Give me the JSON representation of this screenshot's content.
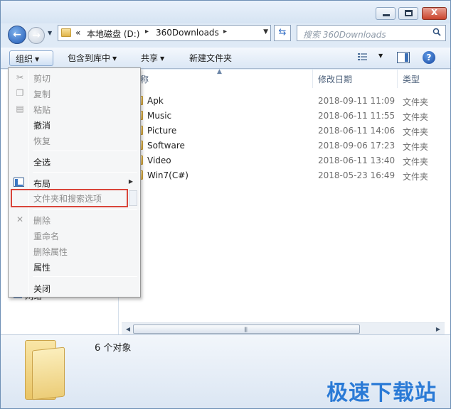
{
  "titlebar": {
    "minimize_glyph": "",
    "maximize_glyph": "",
    "close_glyph": "x"
  },
  "nav": {
    "back_glyph": "←",
    "forward_glyph": "→"
  },
  "address": {
    "overflow": "«",
    "crumbs": [
      "本地磁盘 (D:)",
      "360Downloads"
    ],
    "separator": "▸"
  },
  "search": {
    "placeholder": "搜索 360Downloads"
  },
  "toolbar": {
    "organize": "组织",
    "include_library": "包含到库中",
    "share": "共享",
    "new_folder": "新建文件夹",
    "dropdown": "▼"
  },
  "columns": {
    "name": "名称",
    "date": "修改日期",
    "type": "类型"
  },
  "files": [
    {
      "name": "Apk",
      "date": "2018-09-11 11:09",
      "type": "文件夹"
    },
    {
      "name": "Music",
      "date": "2018-06-11 11:55",
      "type": "文件夹"
    },
    {
      "name": "Picture",
      "date": "2018-06-11 14:06",
      "type": "文件夹"
    },
    {
      "name": "Software",
      "date": "2018-09-06 17:23",
      "type": "文件夹"
    },
    {
      "name": "Video",
      "date": "2018-06-11 13:40",
      "type": "文件夹"
    },
    {
      "name": "Win7(C#)",
      "date": "2018-05-23 16:49",
      "type": "文件夹"
    }
  ],
  "left_pane": {
    "partial_item": "网络"
  },
  "menu": {
    "cut": "剪切",
    "copy": "复制",
    "paste": "粘贴",
    "undo": "撤消",
    "redo": "恢复",
    "select_all": "全选",
    "layout": "布局",
    "folder_options": "文件夹和搜索选项",
    "delete": "删除",
    "rename": "重命名",
    "remove_properties": "删除属性",
    "properties": "属性",
    "close": "关闭"
  },
  "details": {
    "count": "6 个对象"
  },
  "watermark": "极速下载站",
  "colors": {
    "accent": "#2a7ad6",
    "highlight_border": "#d9453a"
  }
}
